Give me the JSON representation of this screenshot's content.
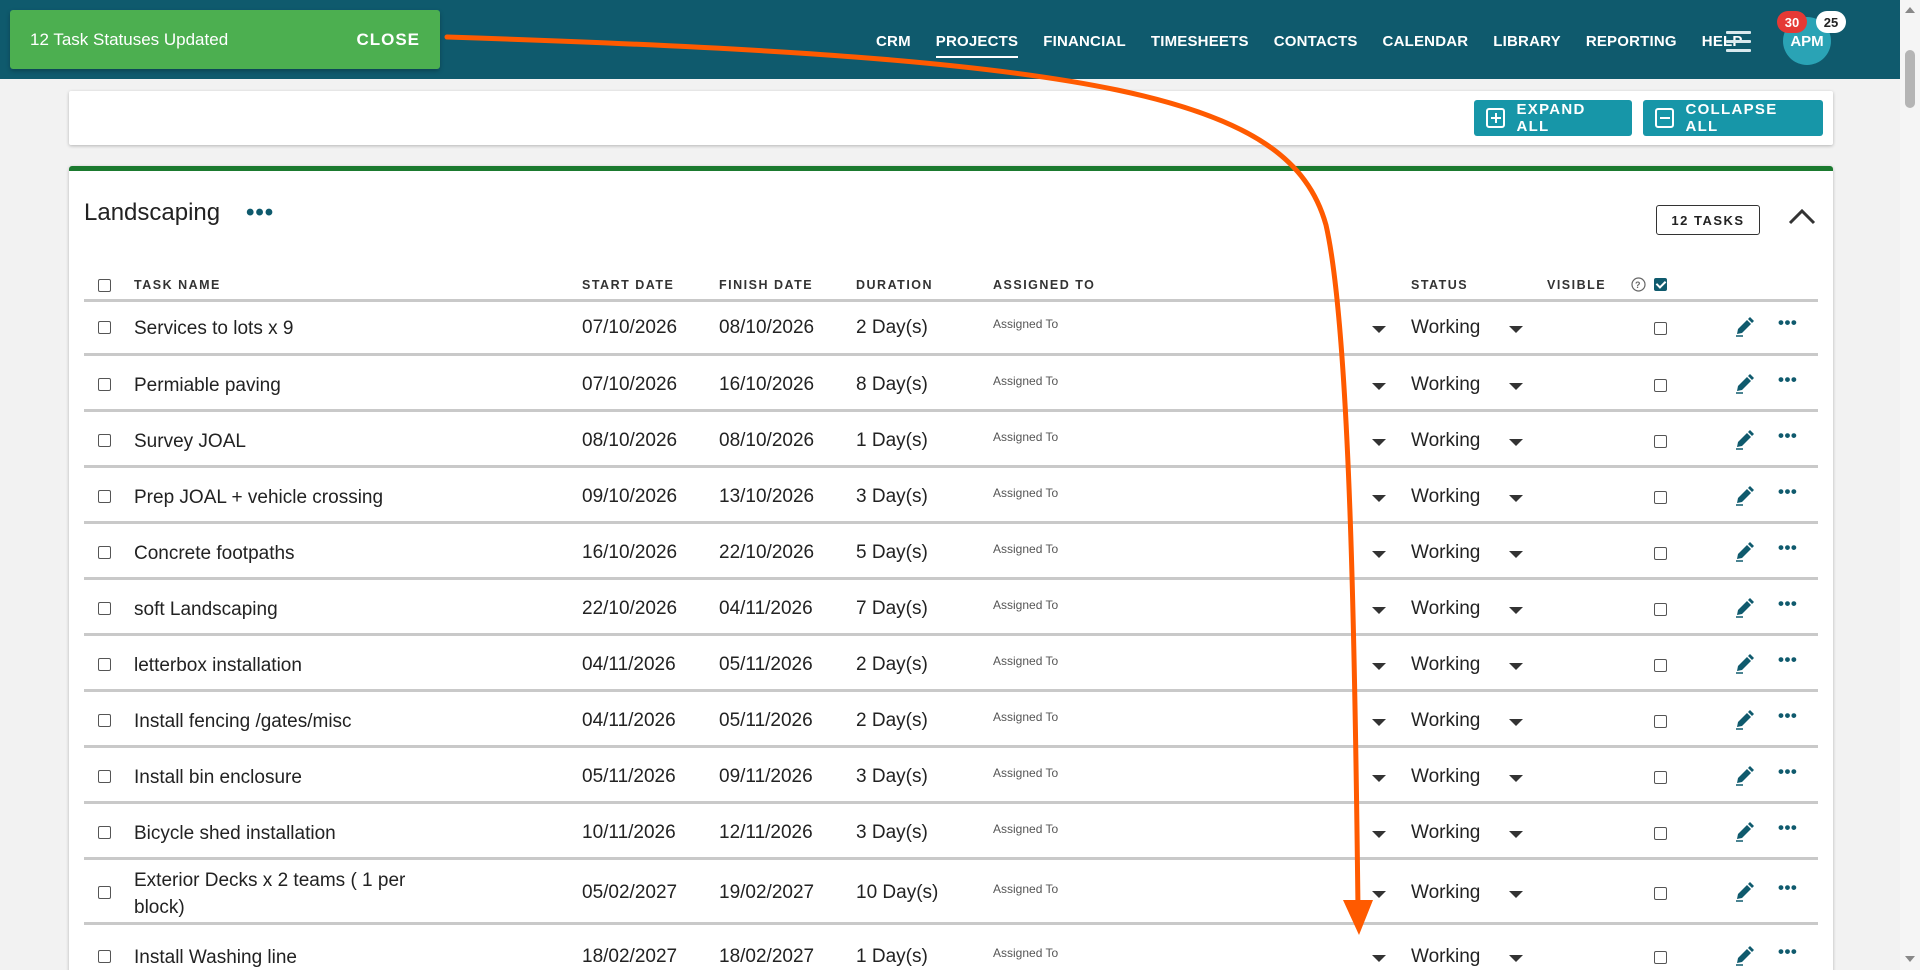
{
  "nav": {
    "items": [
      {
        "label": "CRM",
        "active": false
      },
      {
        "label": "PROJECTS",
        "active": true
      },
      {
        "label": "FINANCIAL",
        "active": false
      },
      {
        "label": "TIMESHEETS",
        "active": false
      },
      {
        "label": "CONTACTS",
        "active": false
      },
      {
        "label": "CALENDAR",
        "active": false
      },
      {
        "label": "LIBRARY",
        "active": false
      },
      {
        "label": "REPORTING",
        "active": false
      },
      {
        "label": "HELP",
        "active": false
      }
    ],
    "notifications_red": "30",
    "notifications_white": "25",
    "avatar_initials": "APM"
  },
  "toast": {
    "message": "12 Task Statuses Updated",
    "close_label": "CLOSE"
  },
  "toolbar": {
    "expand_label": "EXPAND ALL",
    "collapse_label": "COLLAPSE ALL"
  },
  "group": {
    "title": "Landscaping",
    "more_label": "•••",
    "task_count": "12 TASKS",
    "headers": {
      "task_name": "TASK NAME",
      "start_date": "START DATE",
      "finish_date": "FINISH DATE",
      "duration": "DURATION",
      "assigned_to": "ASSIGNED TO",
      "status": "STATUS",
      "visible": "VISIBLE"
    },
    "tasks": [
      {
        "name": "Services to lots x 9",
        "start": "07/10/2026",
        "finish": "08/10/2026",
        "duration": "2 Day(s)",
        "assigned": "Assigned To",
        "status": "Working"
      },
      {
        "name": "Permiable paving",
        "start": "07/10/2026",
        "finish": "16/10/2026",
        "duration": "8 Day(s)",
        "assigned": "Assigned To",
        "status": "Working"
      },
      {
        "name": "Survey JOAL",
        "start": "08/10/2026",
        "finish": "08/10/2026",
        "duration": "1 Day(s)",
        "assigned": "Assigned To",
        "status": "Working"
      },
      {
        "name": "Prep JOAL + vehicle crossing",
        "start": "09/10/2026",
        "finish": "13/10/2026",
        "duration": "3 Day(s)",
        "assigned": "Assigned To",
        "status": "Working"
      },
      {
        "name": "Concrete footpaths",
        "start": "16/10/2026",
        "finish": "22/10/2026",
        "duration": "5 Day(s)",
        "assigned": "Assigned To",
        "status": "Working"
      },
      {
        "name": "soft Landscaping",
        "start": "22/10/2026",
        "finish": "04/11/2026",
        "duration": "7 Day(s)",
        "assigned": "Assigned To",
        "status": "Working"
      },
      {
        "name": "letterbox installation",
        "start": "04/11/2026",
        "finish": "05/11/2026",
        "duration": "2 Day(s)",
        "assigned": "Assigned To",
        "status": "Working"
      },
      {
        "name": "Install fencing /gates/misc",
        "start": "04/11/2026",
        "finish": "05/11/2026",
        "duration": "2 Day(s)",
        "assigned": "Assigned To",
        "status": "Working"
      },
      {
        "name": "Install bin enclosure",
        "start": "05/11/2026",
        "finish": "09/11/2026",
        "duration": "3 Day(s)",
        "assigned": "Assigned To",
        "status": "Working"
      },
      {
        "name": "Bicycle shed installation",
        "start": "10/11/2026",
        "finish": "12/11/2026",
        "duration": "3 Day(s)",
        "assigned": "Assigned To",
        "status": "Working"
      },
      {
        "name": "Exterior Decks x 2 teams ( 1 per block)",
        "start": "05/02/2027",
        "finish": "19/02/2027",
        "duration": "10 Day(s)",
        "assigned": "Assigned To",
        "status": "Working"
      },
      {
        "name": "Install Washing line",
        "start": "18/02/2027",
        "finish": "18/02/2027",
        "duration": "1 Day(s)",
        "assigned": "Assigned To",
        "status": "Working"
      }
    ]
  },
  "colors": {
    "topbar": "#0f5a6d",
    "toast": "#4caf50",
    "button": "#1796a8",
    "group_accent": "#1b7a2f",
    "annotation_arrow": "#ff5a00"
  }
}
